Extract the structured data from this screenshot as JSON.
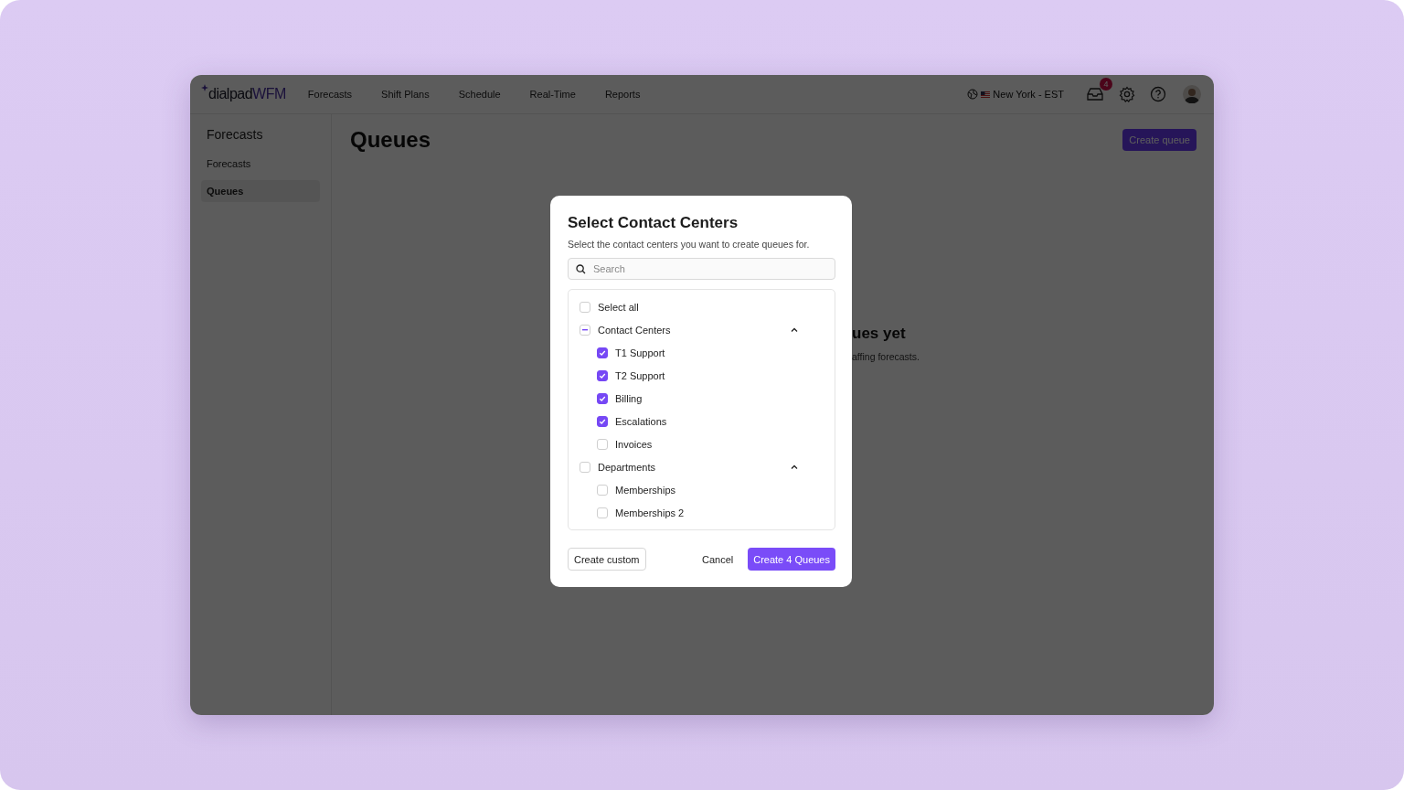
{
  "app": {
    "logo": {
      "brand": "dialpad",
      "product": "WFM"
    },
    "nav": [
      {
        "label": "Forecasts",
        "selected": false
      },
      {
        "label": "Shift Plans",
        "selected": false
      },
      {
        "label": "Schedule",
        "selected": false
      },
      {
        "label": "Real-Time",
        "selected": false
      },
      {
        "label": "Reports",
        "selected": false
      }
    ],
    "timezone": "New York - EST",
    "inbox_badge": "4",
    "sidebar": {
      "title": "Forecasts",
      "items": [
        {
          "label": "Forecasts",
          "selected": false
        },
        {
          "label": "Queues",
          "selected": true
        }
      ]
    },
    "page_title": "Queues",
    "create_button": "Create queue",
    "empty_state": {
      "title": "ues yet",
      "text": "affing forecasts."
    }
  },
  "dialog": {
    "title": "Select Contact Centers",
    "subtitle": "Select the contact centers you want to create queues for.",
    "search": {
      "placeholder": "Search"
    },
    "select_all": {
      "label": "Select all",
      "checked": false
    },
    "groups": [
      {
        "label": "Contact Centers",
        "checked": false,
        "indeterminate": true,
        "expanded": true,
        "children": [
          {
            "label": "T1 Support",
            "checked": true
          },
          {
            "label": "T2 Support",
            "checked": true
          },
          {
            "label": "Billing",
            "checked": true
          },
          {
            "label": "Escalations",
            "checked": true
          },
          {
            "label": "Invoices",
            "checked": false
          }
        ]
      },
      {
        "label": "Departments",
        "checked": false,
        "indeterminate": false,
        "expanded": true,
        "children": [
          {
            "label": "Memberships",
            "checked": false
          },
          {
            "label": "Memberships 2",
            "checked": false
          }
        ]
      }
    ],
    "buttons": {
      "custom": "Create custom",
      "cancel": "Cancel",
      "confirm": "Create 4 Queues"
    }
  }
}
